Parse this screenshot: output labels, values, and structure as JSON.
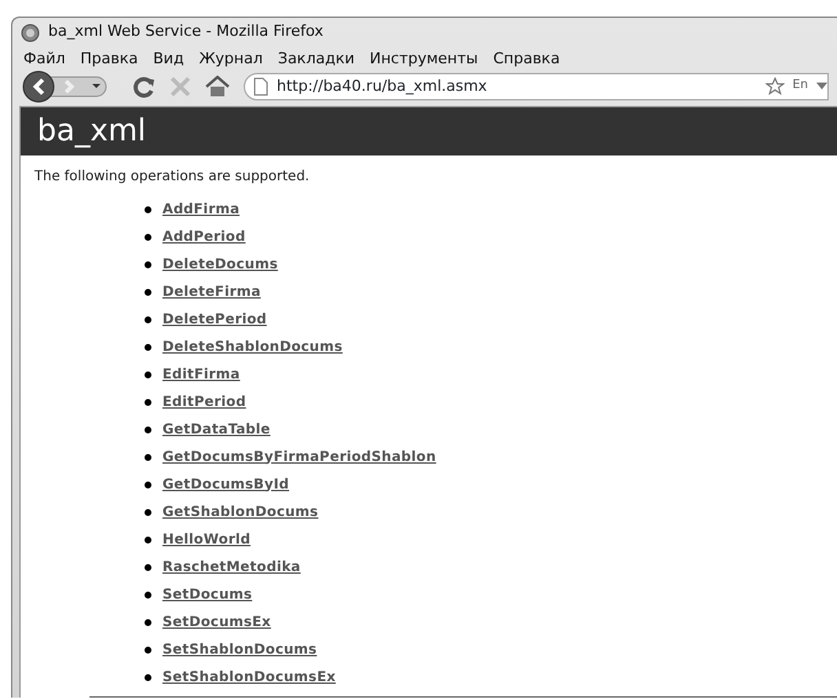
{
  "window": {
    "title": "ba_xml Web Service - Mozilla Firefox"
  },
  "menu": [
    "Файл",
    "Правка",
    "Вид",
    "Журнал",
    "Закладки",
    "Инструменты",
    "Справка"
  ],
  "address_bar": {
    "value": "http://ba40.ru/ba_xml.asmx",
    "language": "En"
  },
  "page": {
    "heading": "ba_xml",
    "intro": "The following operations are supported.",
    "operations": [
      "AddFirma",
      "AddPeriod",
      "DeleteDocums",
      "DeleteFirma",
      "DeletePeriod",
      "DeleteShablonDocums",
      "EditFirma",
      "EditPeriod",
      "GetDataTable",
      "GetDocumsByFirmaPeriodShablon",
      "GetDocumsById",
      "GetShablonDocums",
      "HelloWorld",
      "RaschetMetodika",
      "SetDocums",
      "SetDocumsEx",
      "SetShablonDocums",
      "SetShablonDocumsEx"
    ]
  }
}
